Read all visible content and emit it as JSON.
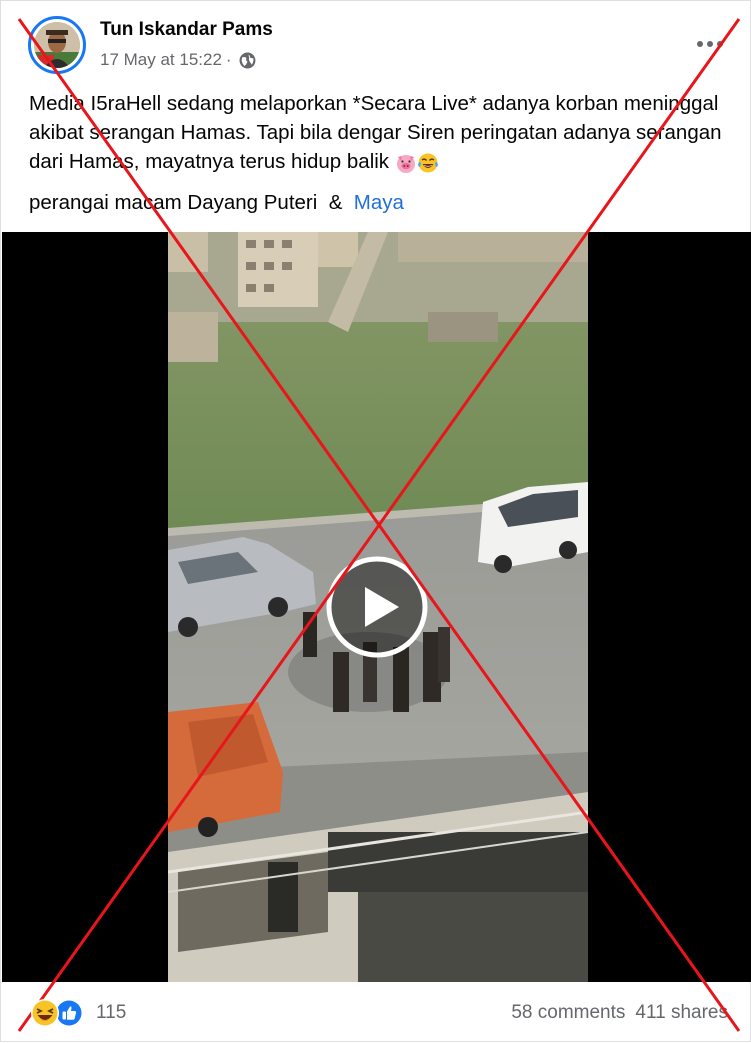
{
  "post": {
    "author": "Tun Iskandar Pams",
    "timestamp": "17 May at 15:22",
    "separator": "·",
    "privacy_icon": "globe-icon",
    "more_icon": "more-options-icon",
    "text_line1": "Media I5raHell sedang melaporkan *Secara Live* adanya korban meninggal akibat serangan Hamas. Tapi bila dengar Siren peringatan adanya serangan dari Hamas, mayatnya terus hidup balik",
    "text_line2_prefix": "perangai macam Dayang Puteri",
    "ampersand": "&",
    "mention": "Maya",
    "emojis": [
      "pig-face-emoji",
      "crying-laughing-emoji"
    ]
  },
  "video": {
    "play_icon": "play-icon"
  },
  "footer": {
    "reaction_icons": [
      "haha-reaction-icon",
      "like-reaction-icon"
    ],
    "reaction_count": "115",
    "comments": "58 comments",
    "shares": "411 shares"
  },
  "colors": {
    "accent_blue": "#1877f2",
    "mention_blue": "#216fdb",
    "muted_text": "#65676b",
    "overlay_red": "#e8151b"
  }
}
